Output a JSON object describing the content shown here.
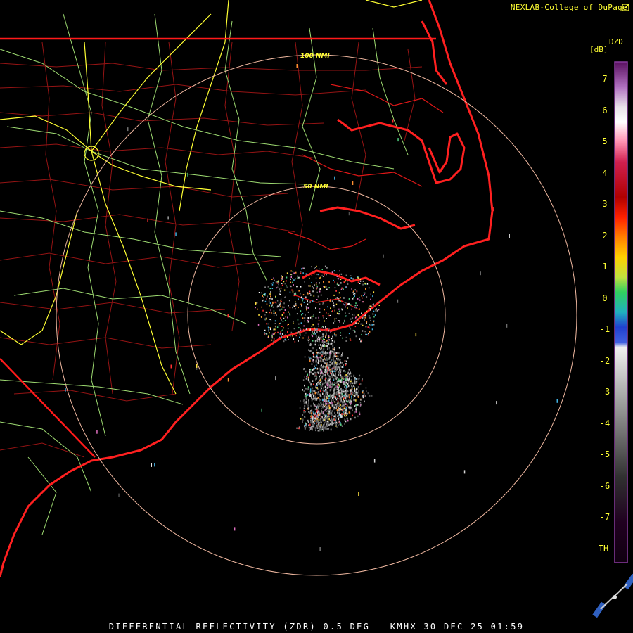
{
  "header": {
    "credit": "NEXLAB-College of DuPage",
    "credit_icon": "external-link-icon"
  },
  "legend": {
    "product": "DZD",
    "unit": "[dB]",
    "ticks": [
      "7",
      "6",
      "5",
      "4",
      "3",
      "2",
      "1",
      "0",
      "-1",
      "-2",
      "-3",
      "-4",
      "-5",
      "-6",
      "-7",
      "TH"
    ]
  },
  "range_rings": {
    "inner_label": "50 NMI",
    "outer_label": "100 NMI"
  },
  "footer": {
    "caption": "DIFFERENTIAL REFLECTIVITY (ZDR) 0.5 DEG - KMHX 30 DEC 25 01:59"
  },
  "colors": {
    "background": "#000000",
    "state_borders": "#ff1a1a",
    "county_lines": "#c41a1a",
    "highways": "#a8e07a",
    "interstates": "#ffff33",
    "range_rings": "#f0b8a0",
    "labels": "#ffff33"
  }
}
